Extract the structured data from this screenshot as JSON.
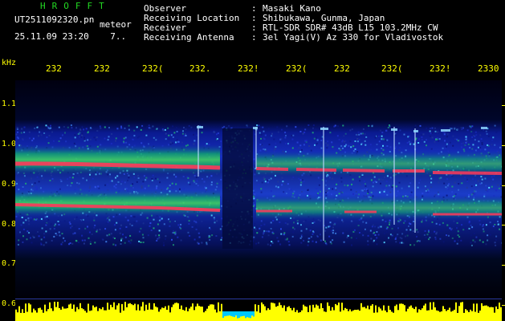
{
  "app": {
    "title": "HROFFT"
  },
  "file": {
    "name": "UT2511092320.pn",
    "meteor_label": "meteor",
    "datetime": "25.11.09 23:20",
    "index": "7.."
  },
  "header": {
    "rows": [
      {
        "label": "Observer",
        "colon": ":",
        "value": "Masaki Kano"
      },
      {
        "label": "Receiving Location",
        "colon": ":",
        "value": "Shibukawa, Gunma, Japan"
      },
      {
        "label": "Receiver",
        "colon": ":",
        "value": "RTL-SDR SDR# 43dB L15 103.2MHz CW"
      },
      {
        "label": "Receiving Antenna",
        "colon": ":",
        "value": "3el Yagi(V) Az 330 for Vladivostok"
      }
    ]
  },
  "axis": {
    "unit": "kHz",
    "x_ticks": [
      "232",
      "232",
      "232(",
      "232.",
      "232!",
      "232(",
      "232",
      "232(",
      "232!",
      "2330"
    ],
    "y_ticks": [
      "1.1",
      "1.0",
      "0.9",
      "0.8",
      "0.7",
      "0.6"
    ]
  },
  "colors": {
    "background": "#000000",
    "axis": "#ffff00",
    "title": "#22d822",
    "text": "#ffffff",
    "signal": "#ff3a5a",
    "noise": "#1a28b0",
    "level": "#ffff00"
  }
}
